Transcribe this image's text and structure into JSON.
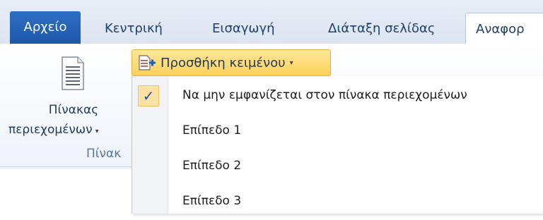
{
  "tabs": {
    "file": "Αρχείο",
    "home": "Κεντρική",
    "insert": "Εισαγωγή",
    "layout": "Διάταξη σελίδας",
    "references": "Αναφορ"
  },
  "toc": {
    "label_line1": "Πίνακας",
    "label_line2": "περιεχομένων",
    "group_label": "Πίνακ"
  },
  "add_text": {
    "label": "Προσθήκη κειμένου",
    "chevron": "▾"
  },
  "menu": {
    "items": [
      {
        "label": "Να μην εμφανίζεται στον πίνακα περιεχομένων",
        "checked": true
      },
      {
        "label": "Επίπεδο 1",
        "checked": false
      },
      {
        "label": "Επίπεδο 2",
        "checked": false
      },
      {
        "label": "Επίπεδο 3",
        "checked": false
      }
    ],
    "check_glyph": "✓"
  },
  "colors": {
    "file_tab": "#2d6fc6",
    "highlight": "#ffd15a",
    "text": "#1e395b"
  }
}
